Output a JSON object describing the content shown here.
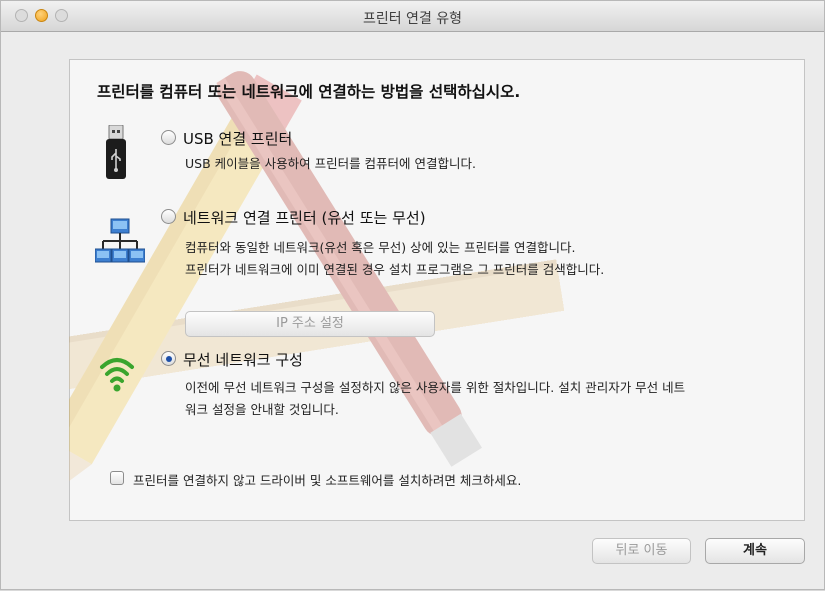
{
  "window": {
    "title": "프린터 연결 유형"
  },
  "heading": "프린터를 컴퓨터 또는 네트워크에 연결하는 방법을 선택하십시오.",
  "options": [
    {
      "label": "USB 연결 프린터",
      "description": [
        "USB 케이블을 사용하여 프린터를 컴퓨터에 연결합니다."
      ],
      "selected": false,
      "icon": "usb-icon"
    },
    {
      "label": "네트워크 연결 프린터 (유선 또는 무선)",
      "description": [
        "컴퓨터와 동일한 네트워크(유선 혹은 무선) 상에 있는 프린터를 연결합니다.",
        "프린터가 네트워크에 이미 연결된 경우 설치 프로그램은 그 프린터를 검색합니다."
      ],
      "selected": false,
      "icon": "network-icon"
    },
    {
      "label": "무선 네트워크 구성",
      "description": [
        "이전에 무선 네트워크 구성을 설정하지 않은 사용자를 위한 절차입니다. 설치 관리자가 무선 네트",
        "워크 설정을 안내할 것입니다."
      ],
      "selected": true,
      "icon": "wifi-icon"
    }
  ],
  "ip_button": {
    "label": "IP 주소 설정",
    "enabled": false
  },
  "checkbox": {
    "label": "프린터를 연결하지 않고 드라이버 및 소프트웨어를 설치하려면 체크하세요.",
    "checked": false
  },
  "footer": {
    "back_label": "뒤로 이동",
    "back_enabled": false,
    "continue_label": "계속"
  },
  "colors": {
    "accent": "#1d4fa8",
    "wifi": "#3aa52e"
  }
}
